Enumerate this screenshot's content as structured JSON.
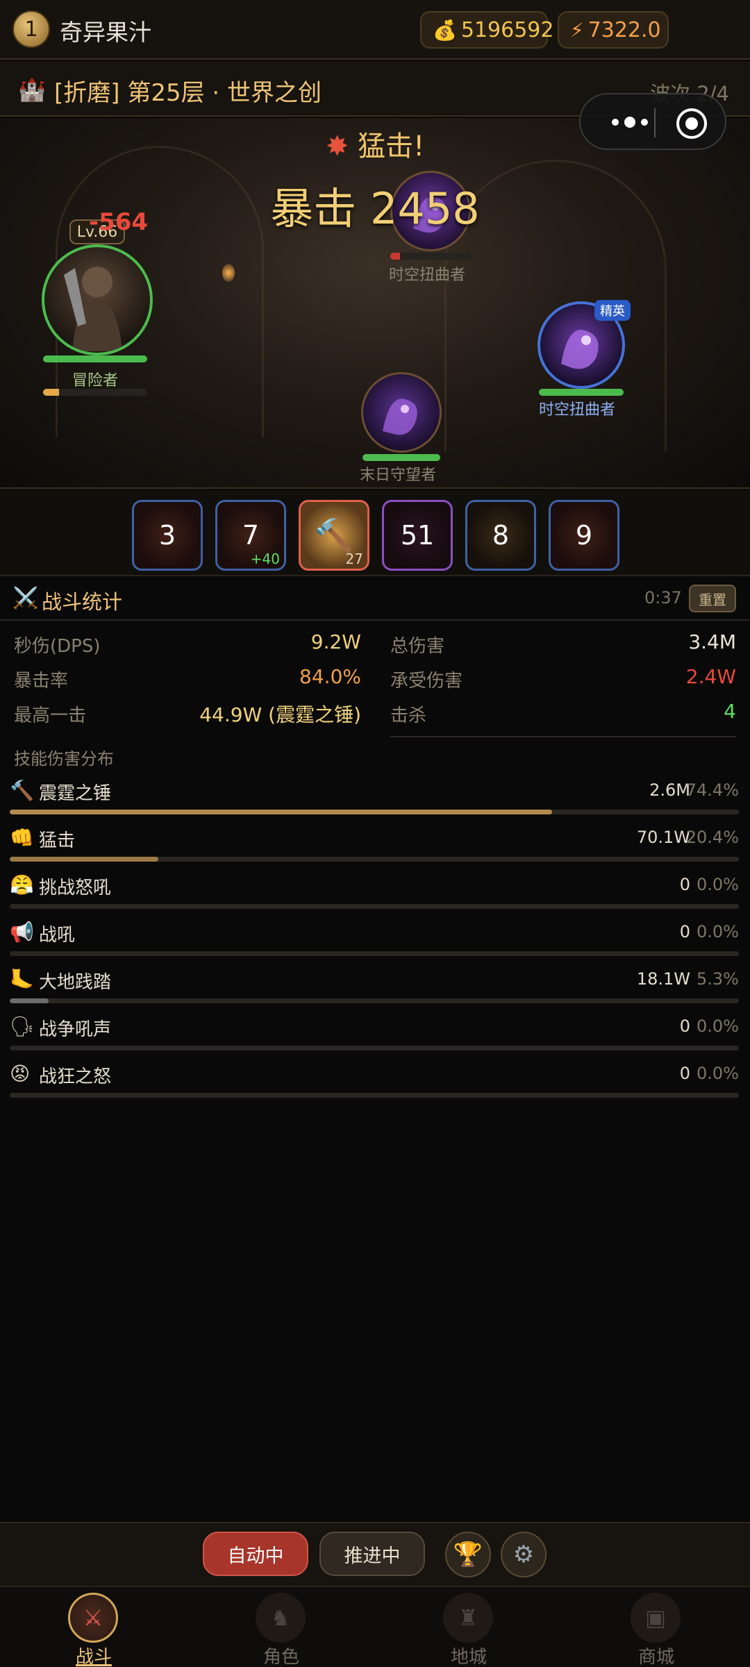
{
  "player": {
    "level": "1",
    "name": "奇异果汁"
  },
  "currency": {
    "gold": "5196592",
    "energy": "7322.0",
    "gold_icon": "money-bag-icon",
    "energy_icon": "lightning-icon"
  },
  "stage": {
    "title": "[折磨] 第25层 · 世界之创",
    "wave": "波次 2/4"
  },
  "battle": {
    "hit_title": "猛击!",
    "crit_text": "暴击 2458",
    "damage_float": "-564",
    "hero": {
      "level_tag": "Lv.66",
      "name": "冒险者",
      "hp": 1.0,
      "energy": 0.15
    },
    "enemies": [
      {
        "name": "时空扭曲者",
        "hp": 0.12,
        "elite": false
      },
      {
        "name": "时空扭曲者",
        "hp": 1.0,
        "elite": true,
        "elite_label": "精英"
      },
      {
        "name": "末日守望者",
        "hp": 1.0,
        "elite": false
      }
    ]
  },
  "skills": [
    {
      "value": "3",
      "sub": ""
    },
    {
      "value": "7",
      "sub": "+40"
    },
    {
      "value": "",
      "sub": "27"
    },
    {
      "value": "51",
      "sub": ""
    },
    {
      "value": "8",
      "sub": ""
    },
    {
      "value": "9",
      "sub": ""
    }
  ],
  "stats": {
    "title": "战斗统计",
    "timer": "0:37",
    "reset_label": "重置",
    "dps_label": "秒伤(DPS)",
    "dps_value": "9.2W",
    "total_label": "总伤害",
    "total_value": "3.4M",
    "crit_label": "暴击率",
    "crit_value": "84.0%",
    "taken_label": "承受伤害",
    "taken_value": "2.4W",
    "max_label": "最高一击",
    "max_value": "44.9W (震霆之锤)",
    "kill_label": "击杀",
    "kill_value": "4",
    "dist_title": "技能伤害分布",
    "skills": [
      {
        "icon": "hammer-icon",
        "glyph": "🔨",
        "name": "震霆之锤",
        "damage": "2.6M",
        "percent": "74.4%",
        "share": 0.744,
        "color": "#b08c4e"
      },
      {
        "icon": "fist-icon",
        "glyph": "👊",
        "name": "猛击",
        "damage": "70.1W",
        "percent": "20.4%",
        "share": 0.204,
        "color": "#9c7a47"
      },
      {
        "icon": "angry-face-icon",
        "glyph": "😤",
        "name": "挑战怒吼",
        "damage": "0",
        "percent": "0.0%",
        "share": 0.0,
        "color": "#8a8270"
      },
      {
        "icon": "megaphone-icon",
        "glyph": "📢",
        "name": "战吼",
        "damage": "0",
        "percent": "0.0%",
        "share": 0.0,
        "color": "#8a8270"
      },
      {
        "icon": "foot-icon",
        "glyph": "🦶",
        "name": "大地践踏",
        "damage": "18.1W",
        "percent": "5.3%",
        "share": 0.053,
        "color": "#6b6b6b"
      },
      {
        "icon": "speaking-head-icon",
        "glyph": "🗣",
        "name": "战争吼声",
        "damage": "0",
        "percent": "0.0%",
        "share": 0.0,
        "color": "#8a8270"
      },
      {
        "icon": "rage-face-icon",
        "glyph": "😡",
        "name": "战狂之怒",
        "damage": "0",
        "percent": "0.0%",
        "share": 0.0,
        "color": "#8a8270"
      }
    ]
  },
  "actions": {
    "auto_label": "自动中",
    "push_label": "推进中",
    "trophy_icon": "trophy-icon",
    "settings_icon": "gear-icon"
  },
  "nav": [
    {
      "label": "战斗",
      "active": true
    },
    {
      "label": "角色",
      "active": false
    },
    {
      "label": "地城",
      "active": false
    },
    {
      "label": "商城",
      "active": false
    }
  ],
  "colors": {
    "accent": "#eec37a",
    "gold": "#f2c453",
    "danger": "#e9493c",
    "success": "#5ee064",
    "orange_value": "#f0a04b"
  }
}
